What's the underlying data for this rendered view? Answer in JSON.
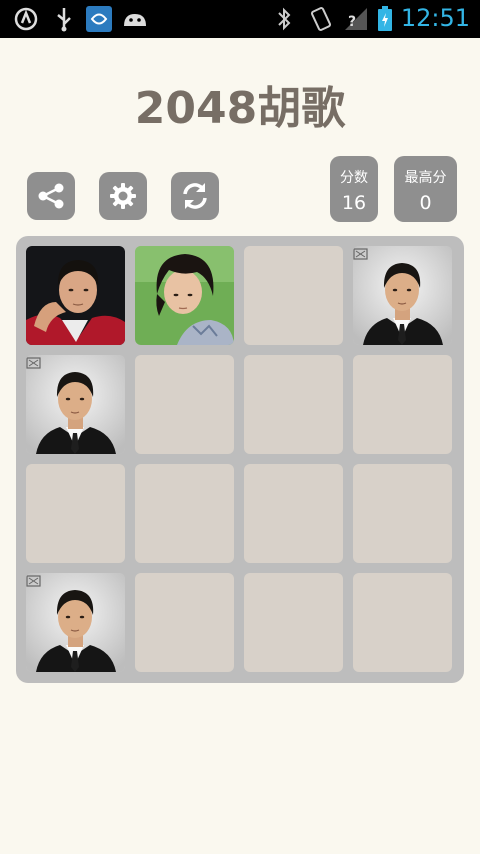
{
  "status_bar": {
    "time": "12:51",
    "icons": [
      "usb-debug-icon",
      "usb-icon",
      "app-notification-icon",
      "android-icon",
      "bluetooth-icon",
      "vibrate-icon",
      "signal-icon",
      "battery-charging-icon"
    ]
  },
  "app": {
    "title": "2048胡歌"
  },
  "toolbar": {
    "buttons": [
      {
        "name": "share-button",
        "icon": "share-icon"
      },
      {
        "name": "settings-button",
        "icon": "gear-icon"
      },
      {
        "name": "restart-button",
        "icon": "refresh-icon"
      }
    ]
  },
  "scores": {
    "score_label": "分数",
    "score_value": "16",
    "best_label": "最高分",
    "best_value": "0"
  },
  "board": {
    "rows": 4,
    "cols": 4,
    "cells": [
      [
        "photo-red-jacket",
        "photo-green-bg",
        "empty",
        "photo-suit"
      ],
      [
        "photo-suit",
        "empty",
        "empty",
        "empty"
      ],
      [
        "empty",
        "empty",
        "empty",
        "empty"
      ],
      [
        "photo-suit",
        "empty",
        "empty",
        "empty"
      ]
    ]
  },
  "colors": {
    "background": "#faf8ef",
    "title": "#776e65",
    "button": "#8f8f8f",
    "board": "#bdbdbd",
    "empty_cell": "#d8d1c9",
    "status_accent": "#33b5e5"
  }
}
